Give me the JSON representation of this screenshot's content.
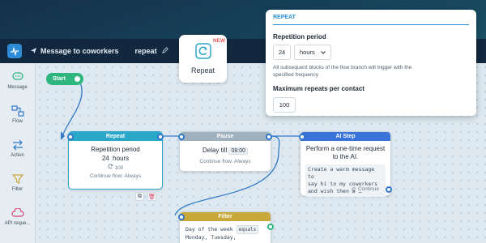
{
  "topbar": {
    "breadcrumb_label": "Message to coworkers",
    "flow_name": "repeat"
  },
  "sidebar": {
    "items": [
      {
        "label": "Message",
        "icon": "chat-bubble-icon"
      },
      {
        "label": "Flow",
        "icon": "flow-icon"
      },
      {
        "label": "Action",
        "icon": "action-arrows-icon"
      },
      {
        "label": "Filter",
        "icon": "filter-icon"
      },
      {
        "label": "API reque...",
        "icon": "cloud-icon"
      }
    ]
  },
  "canvas": {
    "start_label": "Start",
    "repeat_card": {
      "label": "Repeat",
      "badge": "NEW"
    },
    "nodes": {
      "repeat": {
        "title": "Repeat",
        "body_label": "Repetition period",
        "period_value": "24",
        "period_unit": "hours",
        "count": "100",
        "footer": "Continue flow: Always"
      },
      "pause": {
        "title": "Pause",
        "body_label": "Delay till",
        "time_value": "08:00",
        "footer": "Continue flow: Always"
      },
      "ai_step": {
        "title": "AI Step",
        "body_line1": "Perform a one-time request",
        "body_line2": "to the AI.",
        "prompt_line1": "Create a warm message to",
        "prompt_line2": "say hi to my coworkers",
        "prompt_line3": "and wish then a …",
        "footer": "Continue"
      },
      "filter": {
        "title": "Filter",
        "row1_left": "Day of the week",
        "row1_right": "equals",
        "row2": "Monday, Tuesday,"
      }
    }
  },
  "panel": {
    "title": "REPEAT",
    "period_label": "Repetition period",
    "period_value": "24",
    "unit_value": "hours",
    "note_line1": "All subsequent blocks of the flow branch will trigger with the",
    "note_line2": "specified frequency",
    "max_label": "Maximum repeats per contact",
    "max_value": "100"
  },
  "colors": {
    "repeat_head": "#2aa7c9",
    "pause_head": "#9fb0be",
    "ai_head": "#3a73d9",
    "filter_head": "#c9a83a",
    "accent": "#2a8fd4",
    "start": "#2fb67f"
  }
}
